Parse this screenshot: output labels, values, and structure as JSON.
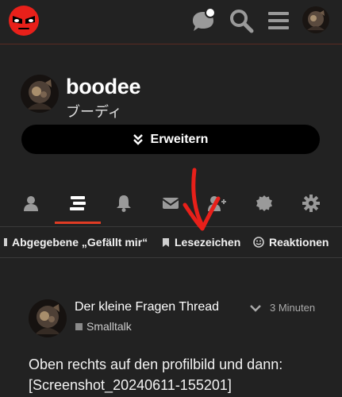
{
  "header": {
    "logo": "angry-face-logo",
    "icons": [
      "chat-icon",
      "search-icon",
      "hamburger-menu-icon",
      "user-avatar"
    ],
    "notification_dot": true
  },
  "profile": {
    "username": "boodee",
    "full_name": "ブーディ",
    "expand_label": "Erweitern"
  },
  "tabs": [
    {
      "name": "summary",
      "icon": "user-icon"
    },
    {
      "name": "activity",
      "icon": "stream-icon",
      "active": true
    },
    {
      "name": "notifications",
      "icon": "bell-icon"
    },
    {
      "name": "messages",
      "icon": "envelope-icon"
    },
    {
      "name": "invites",
      "icon": "user-plus-icon"
    },
    {
      "name": "badges",
      "icon": "certificate-icon"
    },
    {
      "name": "preferences",
      "icon": "gear-icon"
    }
  ],
  "subnav": {
    "likes_given": "Abgegebene „Gefällt mir“",
    "bookmarks": "Lesezeichen",
    "reactions": "Reaktionen"
  },
  "post": {
    "title": "Der kleine Fragen Thread",
    "time": "3 Minuten",
    "category": "Smalltalk",
    "body_line1": "Oben rechts auf den profilbild und dann:",
    "body_line2": "[Screenshot_20240611-155201]"
  },
  "colors": {
    "background": "#222222",
    "accent": "#e03c24",
    "annotation": "#e8201a"
  }
}
